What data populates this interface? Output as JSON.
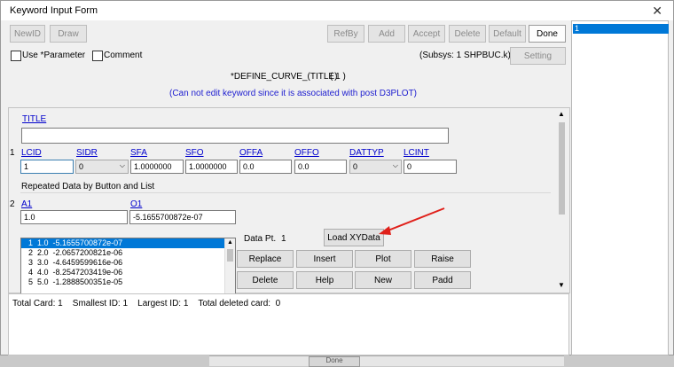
{
  "window": {
    "title": "Keyword Input Form"
  },
  "toolbar": {
    "newid": "NewID",
    "draw": "Draw",
    "refby": "RefBy",
    "add": "Add",
    "accept": "Accept",
    "delete": "Delete",
    "default": "Default",
    "done": "Done"
  },
  "options": {
    "use_parameter": "Use *Parameter",
    "comment": "Comment",
    "subsys": "(Subsys: 1 SHPBUC.k)",
    "setting": "Setting"
  },
  "keyword": {
    "header": "*DEFINE_CURVE_(TITLE)",
    "count": "( 1 )",
    "notice": "(Can not edit keyword since it is associated with post D3PLOT)"
  },
  "card0": {
    "title_label": "TITLE",
    "title_value": ""
  },
  "card1": {
    "number": "1",
    "fields": [
      {
        "label": "LCID",
        "value": "1"
      },
      {
        "label": "SIDR",
        "value": "0"
      },
      {
        "label": "SFA",
        "value": "1.0000000"
      },
      {
        "label": "SFO",
        "value": "1.0000000"
      },
      {
        "label": "OFFA",
        "value": "0.0"
      },
      {
        "label": "OFFO",
        "value": "0.0"
      },
      {
        "label": "DATTYP",
        "value": "0"
      },
      {
        "label": "LCINT",
        "value": "0"
      }
    ]
  },
  "repeated": {
    "heading": "Repeated Data by Button and List"
  },
  "card2": {
    "number": "2",
    "a1_label": "A1",
    "a1_value": "1.0",
    "o1_label": "O1",
    "o1_value": "-5.1655700872e-07"
  },
  "data_list": [
    "1  1.0  -5.1655700872e-07",
    "2  2.0  -2.0657200821e-06",
    "3  3.0  -4.6459599616e-06",
    "4  4.0  -8.2547203419e-06",
    "5  5.0  -1.2888500351e-05"
  ],
  "datapt": {
    "label": "Data Pt.",
    "value": "1"
  },
  "buttons": {
    "load_xydata": "Load XYData",
    "replace": "Replace",
    "insert": "Insert",
    "plot": "Plot",
    "raise": "Raise",
    "delete": "Delete",
    "help": "Help",
    "new": "New",
    "padd": "Padd"
  },
  "status": {
    "text": "Total Card: 1    Smallest ID: 1    Largest ID: 1    Total deleted card:  0"
  },
  "id_list": [
    "1"
  ],
  "background": {
    "button": "Done"
  },
  "colors": {
    "selection": "#0078d7",
    "link": "#0000cc",
    "notice": "#2020d0",
    "arrow": "#e0201a"
  }
}
